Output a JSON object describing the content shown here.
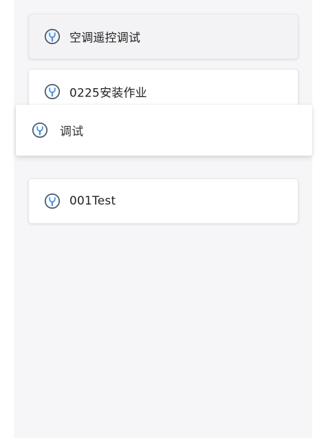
{
  "colors": {
    "list_background": "#f6f6f8",
    "card_background": "#ffffff",
    "icon_ring": "#4a5a6a",
    "icon_accent": "#3f8fe8",
    "text": "#222222"
  },
  "items": [
    {
      "label": "空调遥控调试",
      "icon": "wrench-icon",
      "state": "pressed"
    },
    {
      "label": "0225安装作业",
      "icon": "wrench-icon",
      "state": "normal"
    },
    {
      "label": "调试",
      "icon": "wrench-icon",
      "state": "dragging"
    },
    {
      "label": "001Test",
      "icon": "wrench-icon",
      "state": "normal"
    }
  ]
}
